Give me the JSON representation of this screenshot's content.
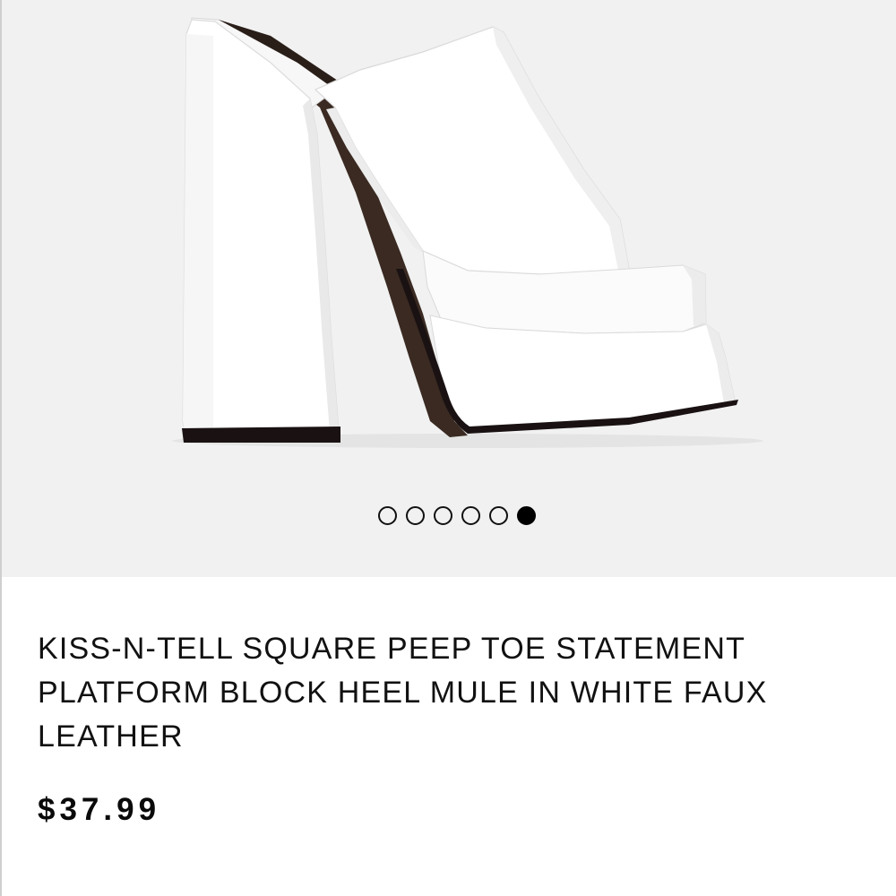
{
  "product": {
    "title": "KISS-N-TELL SQUARE PEEP TOE STATEMENT PLATFORM BLOCK HEEL MULE IN WHITE FAUX LEATHER",
    "price": "$37.99",
    "image_alt": "white platform block heel mule"
  },
  "gallery": {
    "slide_count": 6,
    "active_index": 5
  },
  "colors": {
    "gallery_bg": "#f1f1f1",
    "shoe_white": "#ffffff",
    "sole_dark": "#1a1212",
    "text": "#111111"
  }
}
